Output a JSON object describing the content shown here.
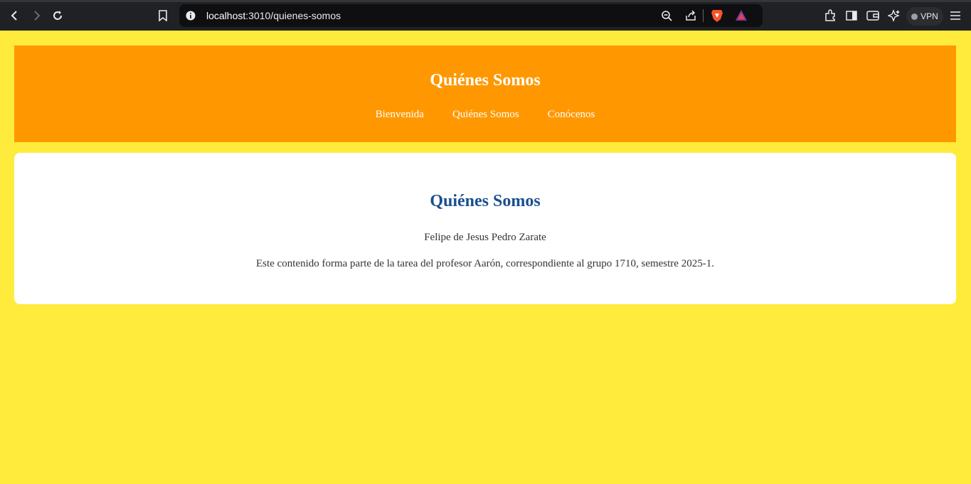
{
  "browser": {
    "url_host": "localhost",
    "url_rest": ":3010/quienes-somos",
    "vpn_label": "VPN"
  },
  "header": {
    "title": "Quiénes Somos",
    "nav": [
      "Bienvenida",
      "Quiénes Somos",
      "Conócenos"
    ]
  },
  "content": {
    "heading": "Quiénes Somos",
    "author": "Felipe de Jesus Pedro Zarate",
    "description": "Este contenido forma parte de la tarea del profesor Aarón, correspondiente al grupo 1710, semestre 2025-1."
  },
  "colors": {
    "page_bg": "#ffeb3b",
    "header_bg": "#ff9800",
    "heading": "#1a4f8f"
  }
}
